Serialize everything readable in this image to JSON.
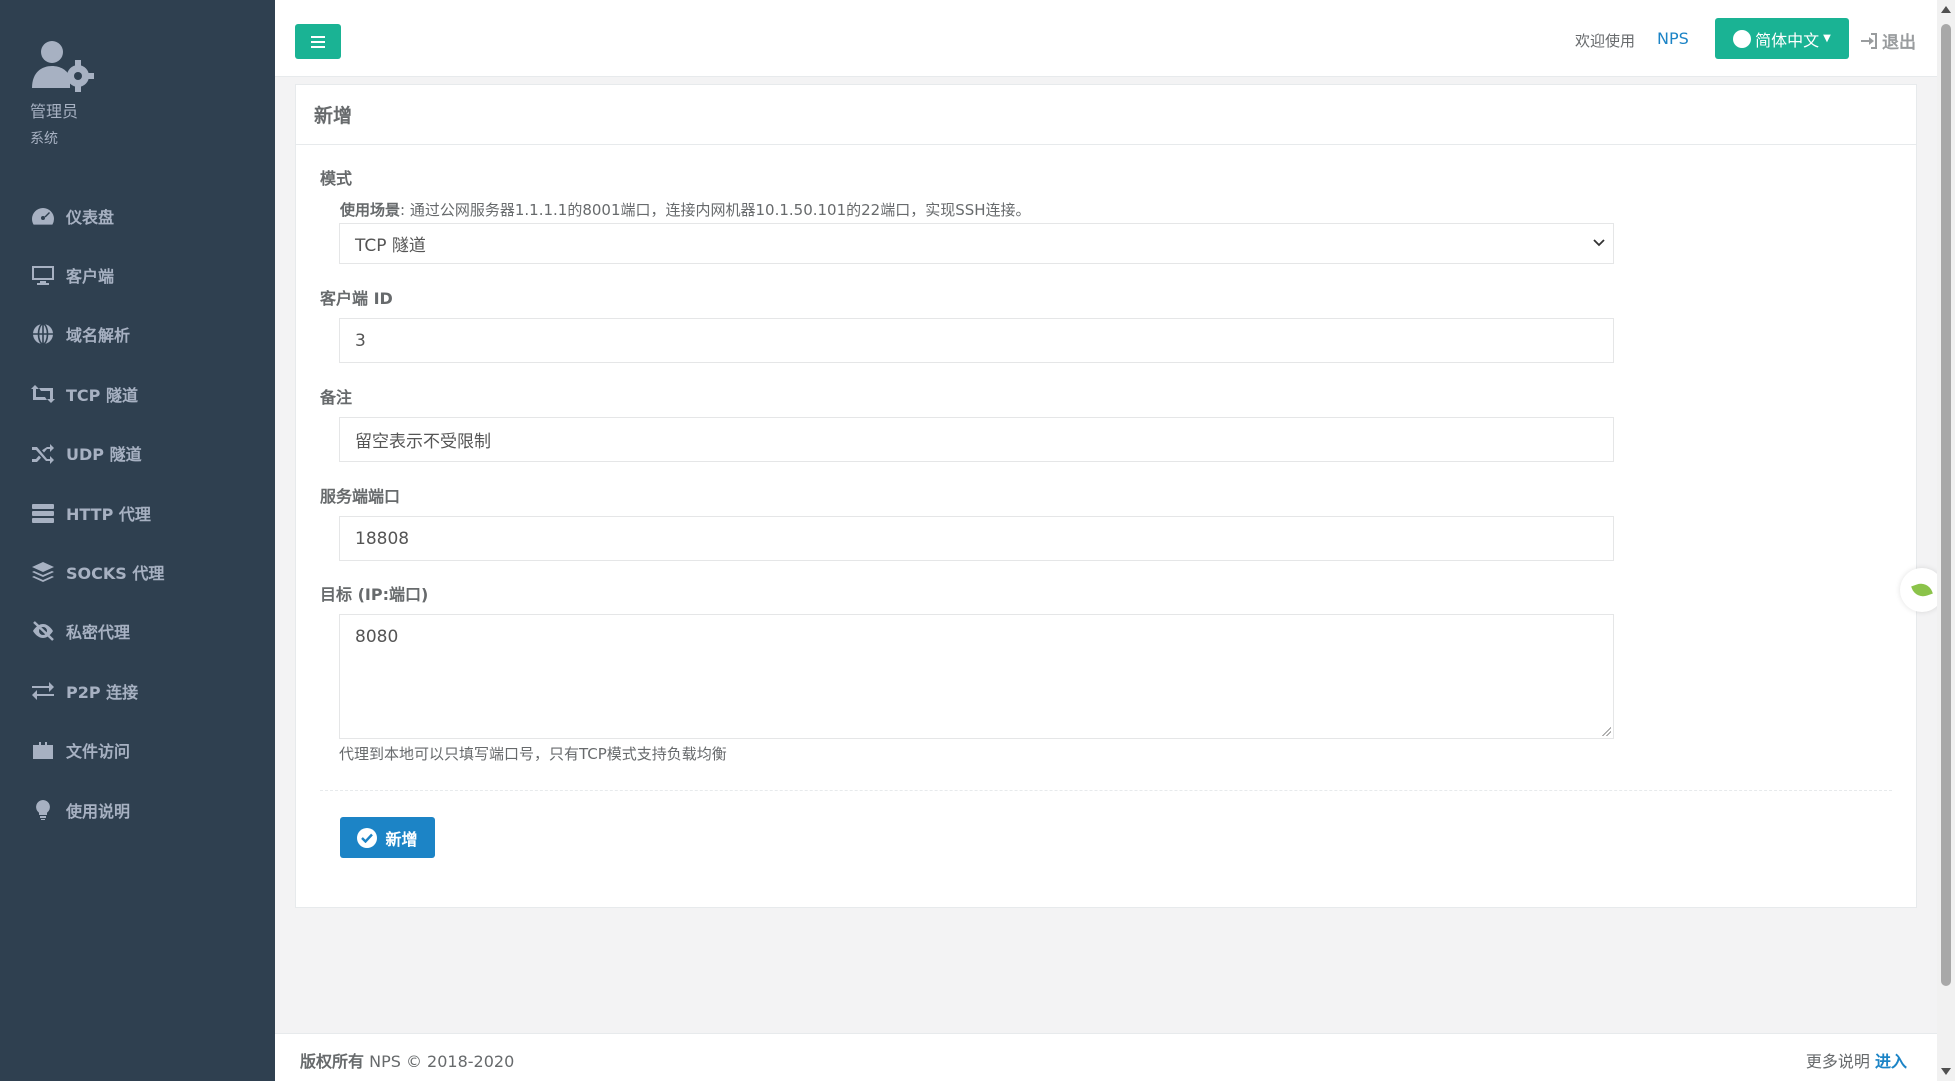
{
  "sidebar": {
    "profile": {
      "name": "管理员",
      "role": "系统"
    },
    "items": [
      {
        "label": "仪表盘",
        "icon": "dashboard-icon"
      },
      {
        "label": "客户端",
        "icon": "desktop-icon"
      },
      {
        "label": "域名解析",
        "icon": "globe-icon"
      },
      {
        "label": "TCP 隧道",
        "icon": "retweet-icon"
      },
      {
        "label": "UDP 隧道",
        "icon": "random-icon"
      },
      {
        "label": "HTTP 代理",
        "icon": "server-icon"
      },
      {
        "label": "SOCKS 代理",
        "icon": "layers-icon"
      },
      {
        "label": "私密代理",
        "icon": "eye-slash-icon"
      },
      {
        "label": "P2P 连接",
        "icon": "exchange-icon"
      },
      {
        "label": "文件访问",
        "icon": "briefcase-icon"
      },
      {
        "label": "使用说明",
        "icon": "lightbulb-icon"
      }
    ]
  },
  "header": {
    "welcome": "欢迎使用",
    "brand": "NPS",
    "language": "简体中文",
    "logout": "退出"
  },
  "form": {
    "title": "新增",
    "mode": {
      "label": "模式",
      "hint_title": "使用场景",
      "hint_text": ": 通过公网服务器1.1.1.1的8001端口，连接内网机器10.1.50.101的22端口，实现SSH连接。",
      "value": "TCP 隧道"
    },
    "client_id": {
      "label": "客户端 ID",
      "value": "3"
    },
    "remark": {
      "label": "备注",
      "placeholder": "留空表示不受限制"
    },
    "server_port": {
      "label": "服务端端口",
      "value": "18808"
    },
    "target": {
      "label": "目标 (IP:端口)",
      "value": "8080",
      "help": "代理到本地可以只填写端口号，只有TCP模式支持负载均衡"
    },
    "submit_label": "新增"
  },
  "footer": {
    "copyright_label": "版权所有",
    "copyright_text": " NPS © 2018-2020",
    "more_label": "更多说明",
    "more_link": "进入"
  },
  "colors": {
    "sidebar": "#2f4050",
    "primary": "#1ab394",
    "accent": "#1c84c6"
  }
}
